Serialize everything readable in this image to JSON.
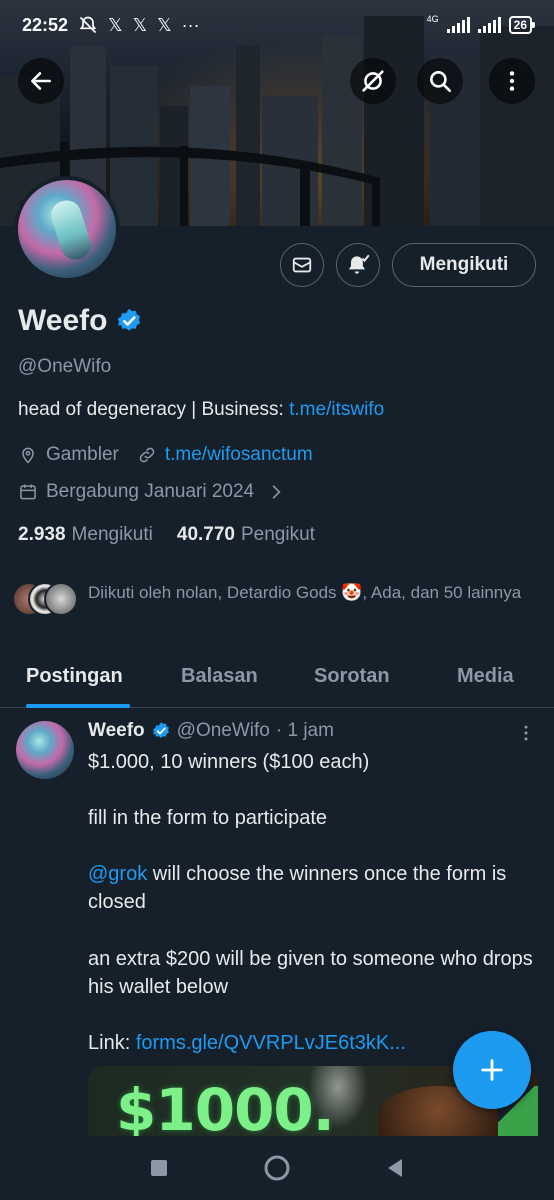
{
  "status_bar": {
    "time": "22:52",
    "notification_icons": [
      "𝕏",
      "𝕏",
      "𝕏"
    ],
    "more": "···",
    "network": "4G",
    "battery": "26"
  },
  "profile": {
    "name": "Weefo",
    "handle": "@OneWifo",
    "bio_text": "head of degeneracy | Business: ",
    "bio_link": "t.me/itswifo",
    "location": "Gambler",
    "website": "t.me/wifosanctum",
    "joined": "Bergabung Januari 2024",
    "following_count": "2.938",
    "following_label": "Mengikuti",
    "followers_count": "40.770",
    "followers_label": "Pengikut",
    "followed_by": "Diikuti oleh nolan, Detardio Gods 🤡, Ada, dan 50 lainnya",
    "follow_button": "Mengikuti"
  },
  "tabs": [
    {
      "label": "Postingan",
      "active": true
    },
    {
      "label": "Balasan",
      "active": false
    },
    {
      "label": "Sorotan",
      "active": false
    },
    {
      "label": "Media",
      "active": false
    }
  ],
  "tweet": {
    "name": "Weefo",
    "handle": "@OneWifo",
    "time": "· 1 jam",
    "line1": "$1.000, 10 winners ($100 each)",
    "line2": "fill in the form to participate",
    "mention": "@grok",
    "line3_rest": " will choose the winners once the form is closed",
    "line4": "an extra $200 will be given to someone who drops his wallet below",
    "link_prefix": "Link: ",
    "link": "forms.gle/QVVRPLvJE6t3kK...",
    "image_text": "$1000."
  },
  "colors": {
    "background": "#15202b",
    "accent": "#1d9bf0",
    "muted": "#8b98a5",
    "text": "#e7e9ea"
  },
  "icons": [
    "arrow-left-icon",
    "grok-icon",
    "search-icon",
    "more-vertical-icon",
    "mail-icon",
    "bell-check-icon",
    "verified-badge-icon",
    "location-icon",
    "link-icon",
    "calendar-icon",
    "chevron-right-icon",
    "plus-icon",
    "nav-square-icon",
    "nav-circle-icon",
    "nav-back-triangle-icon"
  ]
}
